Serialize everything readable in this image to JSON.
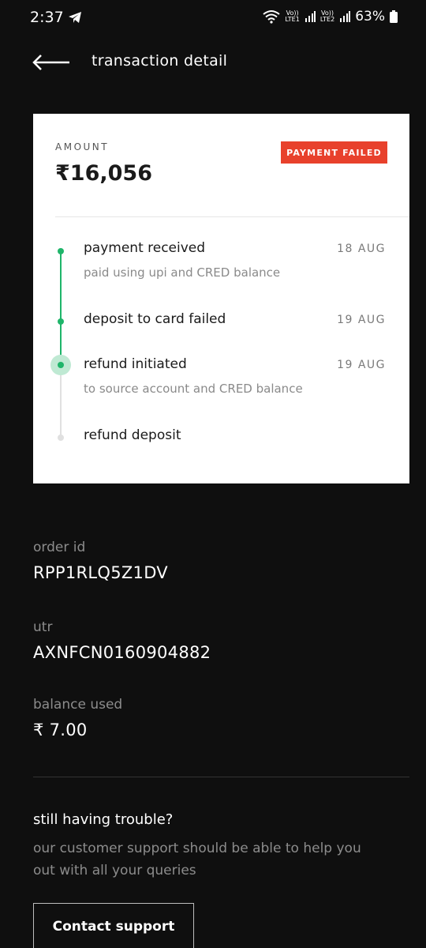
{
  "status_bar": {
    "time": "2:37",
    "lte1": [
      "Vo))",
      "LTE1"
    ],
    "lte2": [
      "Vo))",
      "LTE2"
    ],
    "battery": "63%"
  },
  "header": {
    "title": "transaction detail",
    "back_icon": "back-arrow-icon"
  },
  "card": {
    "amount_label": "AMOUNT",
    "amount": "₹16,056",
    "status_badge": "PAYMENT FAILED",
    "steps": [
      {
        "title": "payment received",
        "subtitle": "paid using upi and CRED balance",
        "date": "18 AUG",
        "state": "done"
      },
      {
        "title": "deposit to card failed",
        "subtitle": "",
        "date": "19 AUG",
        "state": "done"
      },
      {
        "title": "refund initiated",
        "subtitle": "to source account and CRED balance",
        "date": "19 AUG",
        "state": "current"
      },
      {
        "title": "refund deposit",
        "subtitle": "",
        "date": "",
        "state": "pending"
      }
    ]
  },
  "details": {
    "order_id_label": "order id",
    "order_id": "RPP1RLQ5Z1DV",
    "utr_label": "utr",
    "utr": "AXNFCN0160904882",
    "balance_label": "balance used",
    "balance": "₹ 7.00"
  },
  "support": {
    "title": "still having trouble?",
    "text": "our customer support should be able to help you out with all your queries",
    "button": "Contact support"
  },
  "colors": {
    "background": "#0f0f0f",
    "badge": "#e8412c",
    "timeline_green": "#1fb56a"
  }
}
